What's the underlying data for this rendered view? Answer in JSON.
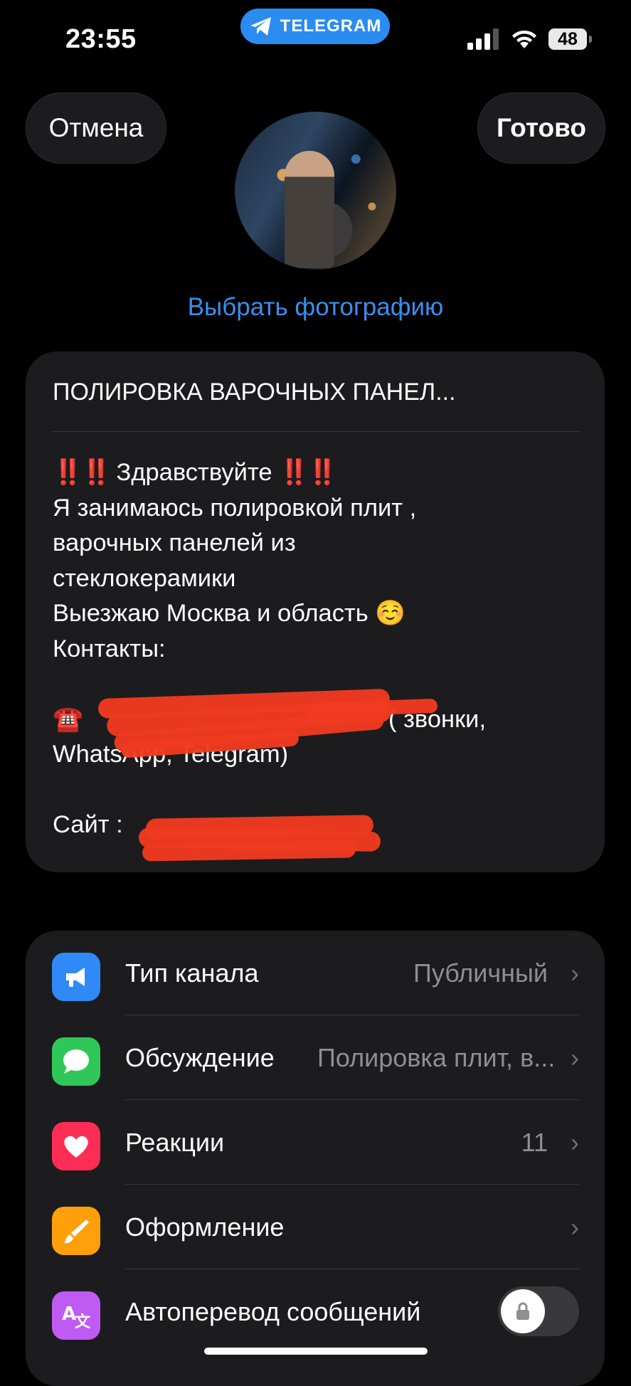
{
  "status_bar": {
    "time": "23:55",
    "app_pill": "TELEGRAM",
    "battery": "48"
  },
  "header": {
    "cancel_label": "Отмена",
    "done_label": "Готово",
    "choose_photo_label": "Выбрать фотографию"
  },
  "channel": {
    "name": "ПОЛИРОВКА ВАРОЧНЫХ ПАНЕЛ...",
    "description_lines": {
      "greeting": "Здравствуйте",
      "line2": "Я занимаюсь полировкой плит ,",
      "line3": "варочных панелей из",
      "line4": "стеклокерамики",
      "line5": "Выезжаю Москва и область",
      "line5_emoji": "☺️",
      "line6": "Контакты:",
      "phone_emoji": "☎️",
      "phone_suffix": "( звонки,",
      "line8": "WhatsApp, Telegram)",
      "site_label": "Сайт :"
    }
  },
  "settings": {
    "items": [
      {
        "label": "Тип канала",
        "value": "Публичный",
        "icon": "megaphone-icon",
        "color": "#2f8af7"
      },
      {
        "label": "Обсуждение",
        "value": "Полировка плит, в...",
        "icon": "chat-bubble-icon",
        "color": "#30c759"
      },
      {
        "label": "Реакции",
        "value": "11",
        "icon": "heart-icon",
        "color": "#fe2d55"
      },
      {
        "label": "Оформление",
        "value": "",
        "icon": "brush-icon",
        "color": "#ff9f0a"
      },
      {
        "label": "Автоперевод сообщений",
        "value": "",
        "icon": "translate-icon",
        "color": "#bf5af2",
        "toggle": false
      }
    ]
  }
}
